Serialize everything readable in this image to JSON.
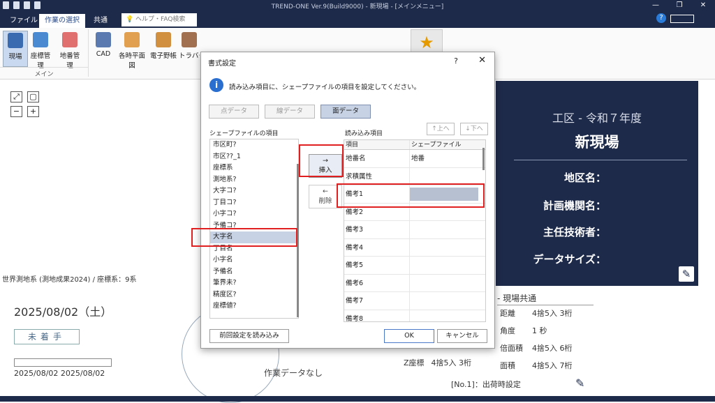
{
  "window": {
    "title": "TREND-ONE Ver.9(Build9000) - 新現場 - [メインメニュー]"
  },
  "tabs": {
    "file": "ファイル",
    "work": "作業の選択",
    "common": "共通",
    "search_placeholder": "ヘルプ・FAQ検索"
  },
  "ribbon": {
    "items": [
      "現場",
      "座標管理",
      "地番管理",
      "CAD",
      "各時平面図",
      "電子野帳",
      "トラバー計算"
    ],
    "group_label": "メイン"
  },
  "right_panel": {
    "subtitle": "工区 - 令和７年度",
    "title": "新現場",
    "rows": [
      "地区名：",
      "計画機関名：",
      "主任技術者：",
      "データサイズ："
    ]
  },
  "coord_system": "世界測地系 (測地成果2024) / 座標系：9系",
  "date": "2025/08/02（土）",
  "status": "未着手",
  "date_range": "2025/08/02 2025/08/02",
  "no_data": "作業データなし",
  "precision": {
    "header": "- 現場共通",
    "rows": [
      [
        "距離",
        "4捨5入 3桁"
      ],
      [
        "角度",
        "1 秒"
      ],
      [
        "倍面積",
        "4捨5入 6桁"
      ],
      [
        "面積",
        "4捨5入 7桁"
      ]
    ],
    "z_label": "Z座標",
    "z_value": "4捨5入 3桁"
  },
  "ship_setting": "[No.1]：出荷時設定",
  "dialog": {
    "title": "書式設定",
    "help": "?",
    "close": "✕",
    "message": "読み込み項目に、シェープファイルの項目を設定してください。",
    "tabs": [
      "点データ",
      "線データ",
      "面データ"
    ],
    "left_label": "シェープファイルの項目",
    "right_label": "読み込み項目",
    "up": "↑上へ",
    "down": "↓下へ",
    "shape_fields": [
      "市区町?",
      "市区??_1",
      "座標系",
      "測地系?",
      "大字コ?",
      "丁目コ?",
      "小字コ?",
      "予備コ?",
      "大字名",
      "丁目名",
      "小字名",
      "予備名",
      "筆界未?",
      "精度区?",
      "座標値?"
    ],
    "insert": "→\n挿入",
    "remove": "←\n削除",
    "grid_header": [
      "項目",
      "シェープファイル"
    ],
    "grid_rows": [
      [
        "地番名",
        "地番"
      ],
      [
        "求積属性",
        ""
      ],
      [
        "備考1",
        ""
      ],
      [
        "備考2",
        ""
      ],
      [
        "備考3",
        ""
      ],
      [
        "備考4",
        ""
      ],
      [
        "備考5",
        ""
      ],
      [
        "備考6",
        ""
      ],
      [
        "備考7",
        ""
      ],
      [
        "備考8",
        ""
      ]
    ],
    "load_prev": "前回設定を読み込み",
    "ok": "OK",
    "cancel": "キャンセル"
  }
}
